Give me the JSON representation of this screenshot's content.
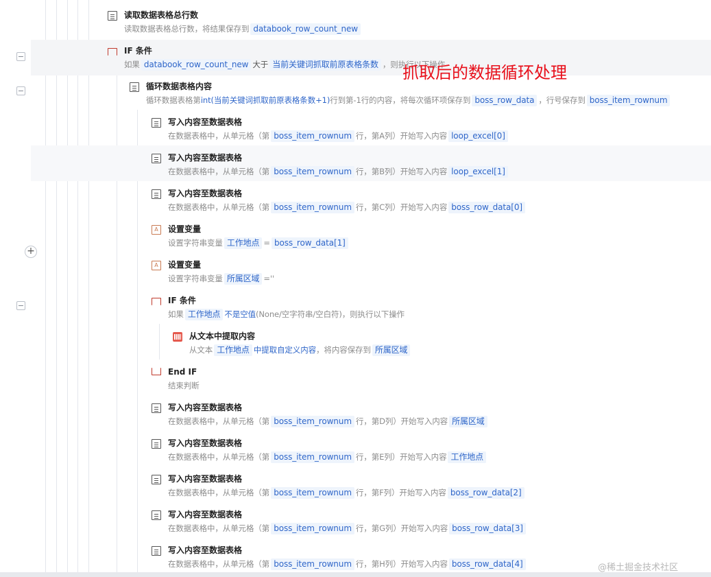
{
  "overlay_title": "抓取后的数据循环处理",
  "watermark": "@稀土掘金技术社区",
  "steps": {
    "read_count": {
      "title": "读取数据表格总行数",
      "desc_prefix": "读取数据表格总行数，将结果保存到",
      "var": "databook_row_count_new"
    },
    "if1": {
      "title": "IF 条件",
      "desc_prefix": "如果",
      "left": "databook_row_count_new",
      "op": "大于",
      "right": "当前关键词抓取前原表格条数",
      "desc_suffix": "，则执行以下操作"
    },
    "loop": {
      "title": "循环数据表格内容",
      "p1": "循环数据表格第",
      "expr": "int(当前关键词抓取前原表格条数+1)",
      "p2": "行到第-1行的内容，将每次循环项保存到",
      "item_var": "boss_row_data",
      "p3": "，行号保存到",
      "row_var": "boss_item_rownum"
    },
    "writes_a": [
      {
        "title": "写入内容至数据表格",
        "p1": "在数据表格中，从单元格（第",
        "row_var": "boss_item_rownum",
        "col": "行，第A列）开始写入内容",
        "value": "loop_excel[0]"
      },
      {
        "title": "写入内容至数据表格",
        "p1": "在数据表格中，从单元格（第",
        "row_var": "boss_item_rownum",
        "col": "行，第B列）开始写入内容",
        "value": "loop_excel[1]"
      },
      {
        "title": "写入内容至数据表格",
        "p1": "在数据表格中，从单元格（第",
        "row_var": "boss_item_rownum",
        "col": "行，第C列）开始写入内容",
        "value": "boss_row_data[0]"
      }
    ],
    "setvar1": {
      "title": "设置变量",
      "p1": "设置字符串变量",
      "var": "工作地点",
      "eq": "=",
      "value": "boss_row_data[1]"
    },
    "setvar2": {
      "title": "设置变量",
      "p1": "设置字符串变量",
      "var": "所属区域",
      "eq": "=''"
    },
    "if2": {
      "title": "IF 条件",
      "p1": "如果",
      "var": "工作地点",
      "cond": "不是空值",
      "p2": "(None/空字符串/空白符)，则执行以下操作"
    },
    "extract": {
      "title": "从文本中提取内容",
      "p1": "从文本",
      "var": "工作地点",
      "mid": "中提取自定义内容",
      "p2": "，将内容保存到",
      "out": "所属区域"
    },
    "endif": {
      "title": "End IF",
      "desc": "结束判断"
    },
    "writes_b": [
      {
        "title": "写入内容至数据表格",
        "p1": "在数据表格中，从单元格（第",
        "row_var": "boss_item_rownum",
        "col": "行，第D列）开始写入内容",
        "value": "所属区域"
      },
      {
        "title": "写入内容至数据表格",
        "p1": "在数据表格中，从单元格（第",
        "row_var": "boss_item_rownum",
        "col": "行，第E列）开始写入内容",
        "value": "工作地点"
      },
      {
        "title": "写入内容至数据表格",
        "p1": "在数据表格中，从单元格（第",
        "row_var": "boss_item_rownum",
        "col": "行，第F列）开始写入内容",
        "value": "boss_row_data[2]"
      },
      {
        "title": "写入内容至数据表格",
        "p1": "在数据表格中，从单元格（第",
        "row_var": "boss_item_rownum",
        "col": "行，第G列）开始写入内容",
        "value": "boss_row_data[3]"
      },
      {
        "title": "写入内容至数据表格",
        "p1": "在数据表格中，从单元格（第",
        "row_var": "boss_item_rownum",
        "col": "行，第H列）开始写入内容",
        "value": "boss_row_data[4]"
      }
    ]
  },
  "gutter": {
    "collapse_symbol": "−",
    "add_symbol": "+"
  },
  "colors": {
    "tag_bg": "#eef4fc",
    "tag_text": "#2f66c9",
    "title_red": "#e8101b",
    "band": "#f4f5f7"
  }
}
